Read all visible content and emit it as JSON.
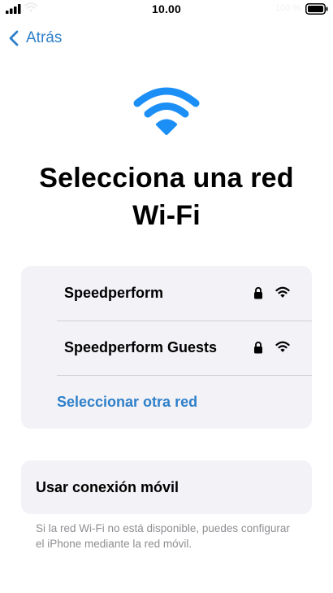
{
  "status_bar": {
    "time": "10.00",
    "battery_label": "100 %",
    "icons": [
      "signal-icon",
      "wifi-icon",
      "battery-icon"
    ]
  },
  "nav": {
    "back_label": "Atrás",
    "back_icon": "chevron-left-icon"
  },
  "hero": {
    "icon": "wifi-icon",
    "title": "Selecciona una red Wi-Fi"
  },
  "networks": {
    "items": [
      {
        "name": "Speedperform",
        "secured": true,
        "icons": [
          "lock-icon",
          "wifi-icon"
        ]
      },
      {
        "name": "Speedperform Guests",
        "secured": true,
        "icons": [
          "lock-icon",
          "wifi-icon"
        ]
      }
    ],
    "other_label": "Seleccionar otra red"
  },
  "cellular": {
    "label": "Usar conexión móvil",
    "note": "Si la red Wi-Fi no está disponible, puedes configurar el iPhone mediante la red móvil."
  },
  "colors": {
    "accent": "#2f80c9",
    "hero_icon": "#1c8ff6",
    "card_background": "#f2f2f7",
    "secondary_text": "#8e8e93",
    "separator": "#d1d1d6"
  }
}
